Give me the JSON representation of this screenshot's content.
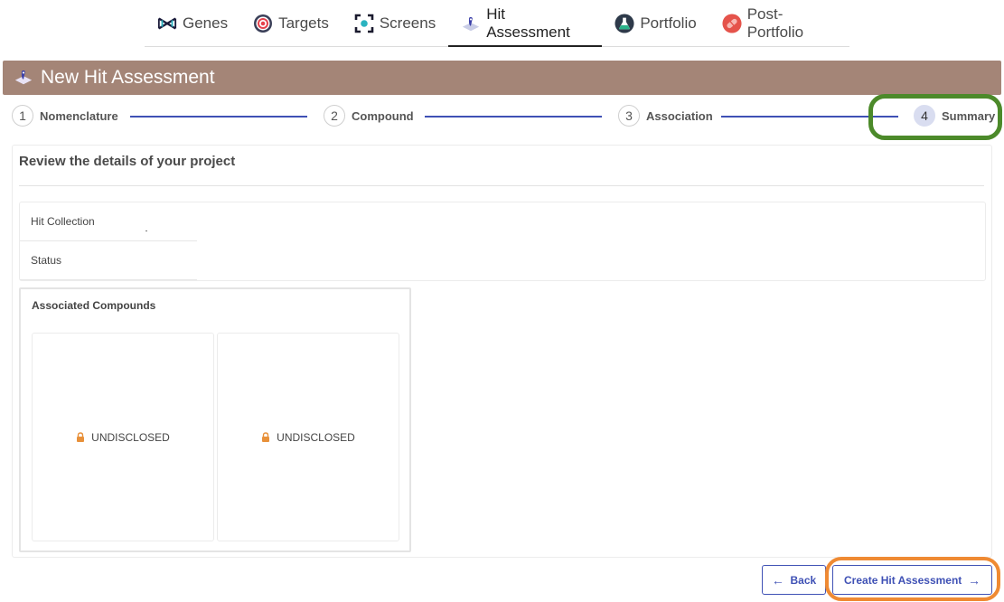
{
  "nav": {
    "items": [
      {
        "label": "Genes",
        "icon": "dna-icon"
      },
      {
        "label": "Targets",
        "icon": "target-icon"
      },
      {
        "label": "Screens",
        "icon": "screen-icon"
      },
      {
        "label": "Hit Assessment",
        "icon": "hit-assessment-icon",
        "active": true
      },
      {
        "label": "Portfolio",
        "icon": "flask-icon"
      },
      {
        "label": "Post-Portfolio",
        "icon": "capsule-icon"
      }
    ]
  },
  "header": {
    "title": "New Hit Assessment",
    "background": "#a48577"
  },
  "stepper": {
    "steps": [
      {
        "number": "1",
        "label": "Nomenclature"
      },
      {
        "number": "2",
        "label": "Compound"
      },
      {
        "number": "3",
        "label": "Association"
      },
      {
        "number": "4",
        "label": "Summary",
        "current": true
      }
    ],
    "line_color": "#3f51b5"
  },
  "summary": {
    "title": "Review the details of your project",
    "fields": [
      {
        "label": "Hit Collection",
        "value": ""
      },
      {
        "label": "Status",
        "value": ""
      }
    ],
    "associated_compounds": {
      "title": "Associated Compounds",
      "items": [
        {
          "label": "UNDISCLOSED",
          "icon": "lock-icon"
        },
        {
          "label": "UNDISCLOSED",
          "icon": "lock-icon"
        }
      ]
    }
  },
  "actions": {
    "back_arrow": "←",
    "back_label": "Back",
    "create_label": "Create Hit Assessment",
    "create_arrow": "→"
  },
  "colors": {
    "accent": "#3f51b5",
    "highlight_green": "#4c8a2a",
    "highlight_orange": "#ef8a33",
    "lock": "#e8913a"
  }
}
